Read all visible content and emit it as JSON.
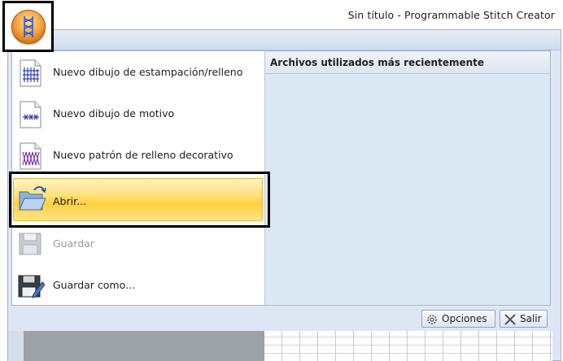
{
  "window": {
    "title": "Sin título - Programmable Stitch Creator"
  },
  "app_menu": {
    "items": [
      {
        "label": "Nuevo dibujo de estampación/relleno",
        "icon": "new-stamp-fill-icon",
        "state": "normal"
      },
      {
        "label": "Nuevo dibujo de motivo",
        "icon": "new-motif-icon",
        "state": "normal"
      },
      {
        "label": "Nuevo patrón de relleno decorativo",
        "icon": "new-decorative-fill-icon",
        "state": "normal"
      },
      {
        "label": "Abrir...",
        "icon": "open-folder-icon",
        "state": "selected"
      },
      {
        "label": "Guardar",
        "icon": "save-disk-icon",
        "state": "disabled"
      },
      {
        "label": "Guardar como...",
        "icon": "save-as-icon",
        "state": "normal"
      }
    ],
    "recent_header": "Archivos utilizados más recientemente",
    "options_button": "Opciones",
    "exit_button": "Salir"
  },
  "colors": {
    "accent_selected": "#ffd04a",
    "panel_bg": "#dce7f4"
  }
}
